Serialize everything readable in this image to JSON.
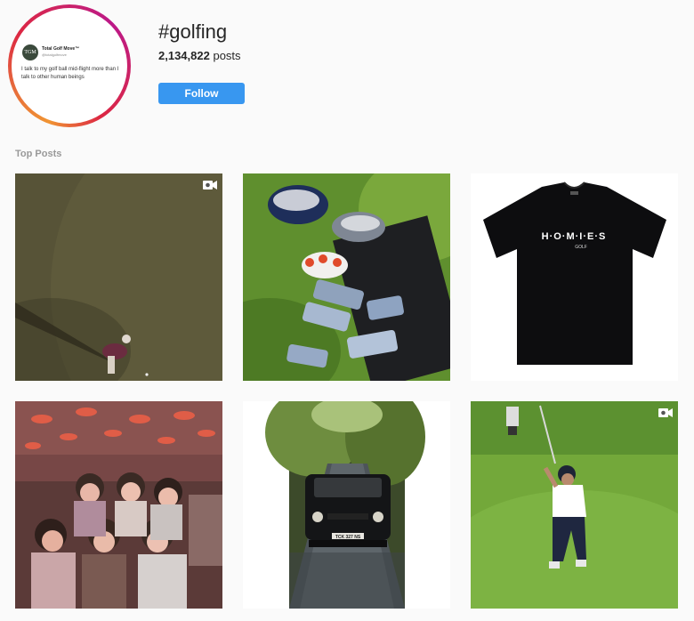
{
  "profile": {
    "account_name": "Total Golf Move™",
    "account_handle": "@totalgolfmove",
    "logo_text": "TGM",
    "quote": "I talk to my golf ball mid-flight more than I talk to other human beings"
  },
  "header": {
    "hashtag": "#golfing",
    "post_count": "2,134,822",
    "post_count_label": "posts",
    "follow_label": "Follow"
  },
  "sections": {
    "top_posts_label": "Top Posts"
  },
  "posts": [
    {
      "kind": "video",
      "subject": "aerial view of golfer on green"
    },
    {
      "kind": "image",
      "subject": "golf clubs in bag"
    },
    {
      "kind": "image",
      "subject": "black t-shirt",
      "shirt_text": "H·O·M·I·E·S",
      "shirt_subtext": "GOLF"
    },
    {
      "kind": "image",
      "subject": "group of women in bar"
    },
    {
      "kind": "multi",
      "subject": "black car on wet road",
      "plate_text": "TCK 327 NS"
    },
    {
      "kind": "video",
      "subject": "golfer follow-through swing"
    }
  ],
  "colors": {
    "follow_button": "#3897f0",
    "accent_ring": "#dc2743"
  }
}
